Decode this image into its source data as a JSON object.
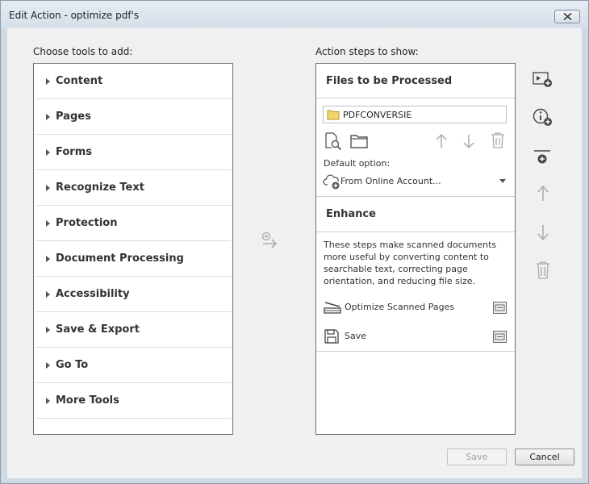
{
  "window": {
    "title": "Edit Action - optimize pdf's"
  },
  "left_panel": {
    "label": "Choose tools to add:",
    "tools": [
      {
        "label": "Content"
      },
      {
        "label": "Pages"
      },
      {
        "label": "Forms"
      },
      {
        "label": "Recognize Text"
      },
      {
        "label": "Protection"
      },
      {
        "label": "Document Processing"
      },
      {
        "label": "Accessibility"
      },
      {
        "label": "Save & Export"
      },
      {
        "label": "Go To"
      },
      {
        "label": "More Tools"
      }
    ]
  },
  "right_panel": {
    "label": "Action steps to show:",
    "files_section": {
      "title": "Files to be Processed",
      "folder": "PDFCONVERSIE",
      "default_option_label": "Default option:",
      "default_option_value": "From Online Account..."
    },
    "enhance_section": {
      "title": "Enhance",
      "description": "These steps make scanned documents more useful by converting content to searchable text, correcting page orientation, and reducing file size.",
      "steps": [
        {
          "label": "Optimize Scanned Pages"
        },
        {
          "label": "Save"
        }
      ]
    }
  },
  "buttons": {
    "save": "Save",
    "cancel": "Cancel"
  }
}
